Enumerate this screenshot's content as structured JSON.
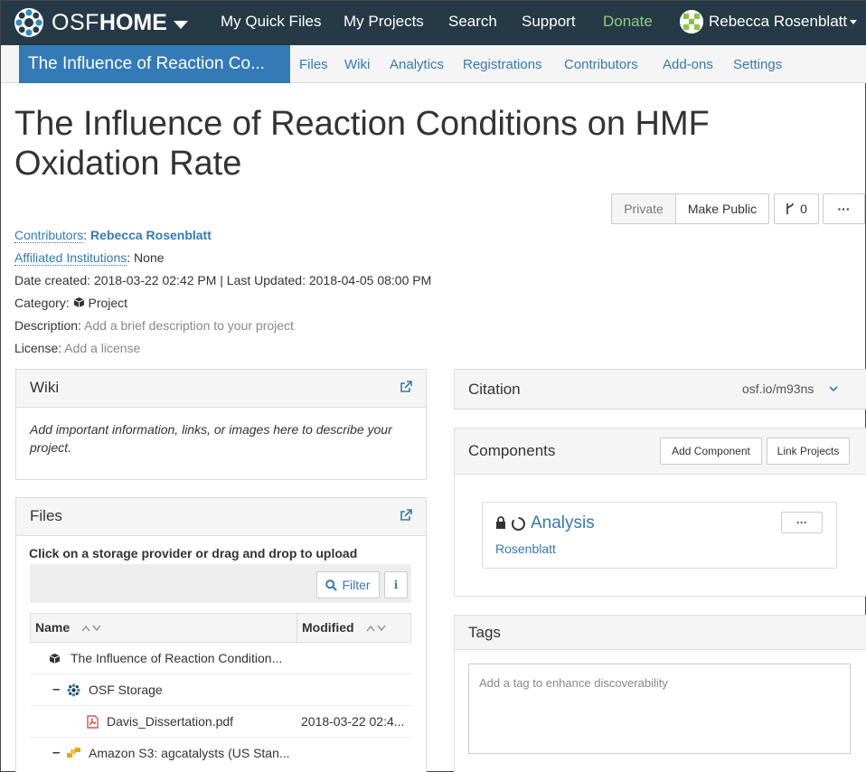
{
  "navbar": {
    "brand_osf": "OSF",
    "brand_home": "HOME",
    "links": [
      "My Quick Files",
      "My Projects",
      "Search",
      "Support",
      "Donate"
    ],
    "user_name": "Rebecca Rosenblatt",
    "bg_color": "#263947",
    "donate_color": "#8ccd7f"
  },
  "subnav": {
    "project_tab": "The Influence of Reaction Co...",
    "links": [
      "Files",
      "Wiki",
      "Analytics",
      "Registrations",
      "Contributors",
      "Add-ons",
      "Settings"
    ]
  },
  "project": {
    "title": "The Influence of Reaction Conditions on HMF Oxidation Rate",
    "private_label": "Private",
    "make_public_label": "Make Public",
    "fork_count": "0",
    "more_label": "···",
    "contributors_label": "Contributors",
    "contributor_name": "Rebecca Rosenblatt",
    "affiliated_label": "Affiliated Institutions",
    "affiliated_value": "None",
    "dates": "Date created: 2018-03-22 02:42 PM | Last Updated: 2018-04-05 08:00 PM",
    "category_label": "Category:",
    "category_value": "Project",
    "description_label": "Description:",
    "description_value": "Add a brief description to your project",
    "license_label": "License:",
    "license_value": "Add a license"
  },
  "wiki": {
    "title": "Wiki",
    "body": "Add important information, links, or images here to describe your project."
  },
  "files": {
    "title": "Files",
    "instruction": "Click on a storage provider or drag and drop to upload",
    "filter_label": "Filter",
    "col_name": "Name",
    "col_modified": "Modified",
    "rows": [
      {
        "name": "The Influence of Reaction Condition...",
        "modified": ""
      },
      {
        "name": "OSF Storage",
        "modified": ""
      },
      {
        "name": "Davis_Dissertation.pdf",
        "modified": "2018-03-22 02:4..."
      },
      {
        "name": "Amazon S3: agcatalysts (US Stan...",
        "modified": ""
      }
    ]
  },
  "citation": {
    "title": "Citation",
    "link": "osf.io/m93ns"
  },
  "components": {
    "title": "Components",
    "add_label": "Add Component",
    "link_label": "Link Projects",
    "item_title": "Analysis",
    "item_contributor": "Rosenblatt",
    "item_more": "···"
  },
  "tags": {
    "title": "Tags",
    "placeholder": "Add a tag to enhance discoverability"
  }
}
